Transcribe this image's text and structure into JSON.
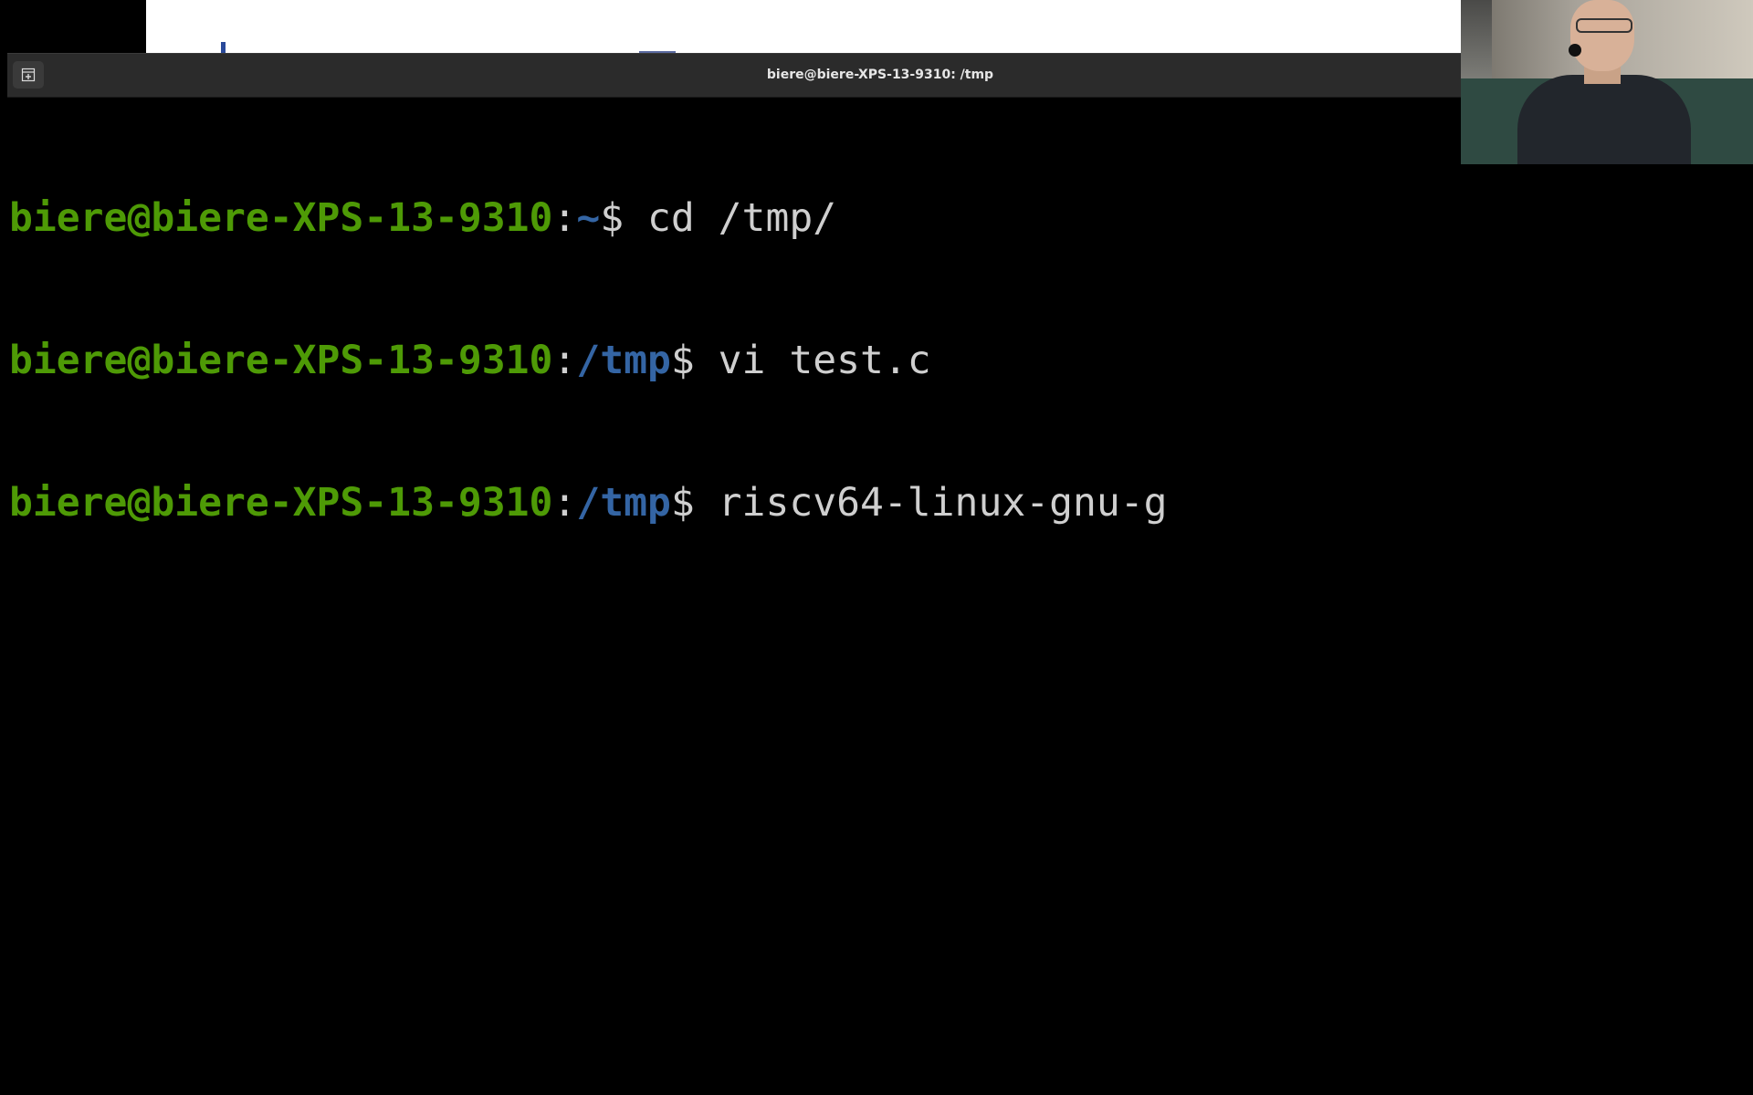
{
  "terminal": {
    "title": "biere@biere-XPS-13-9310: /tmp",
    "new_tab_icon": "new-tab-icon",
    "lines": [
      {
        "user": "biere@biere-XPS-13-9310",
        "sep": ":",
        "path": "~",
        "prompt": "$ ",
        "command": "cd /tmp/"
      },
      {
        "user": "biere@biere-XPS-13-9310",
        "sep": ":",
        "path": "/tmp",
        "prompt": "$ ",
        "command": "vi test.c"
      },
      {
        "user": "biere@biere-XPS-13-9310",
        "sep": ":",
        "path": "/tmp",
        "prompt": "$ ",
        "command": "riscv64-linux-gnu-g"
      }
    ]
  },
  "colors": {
    "user": "#4e9a06",
    "path": "#3465a4",
    "text": "#cfcfcf",
    "background": "#000000",
    "titlebar": "#2b2b2b"
  },
  "webcam": {
    "content": "presenter-video"
  }
}
